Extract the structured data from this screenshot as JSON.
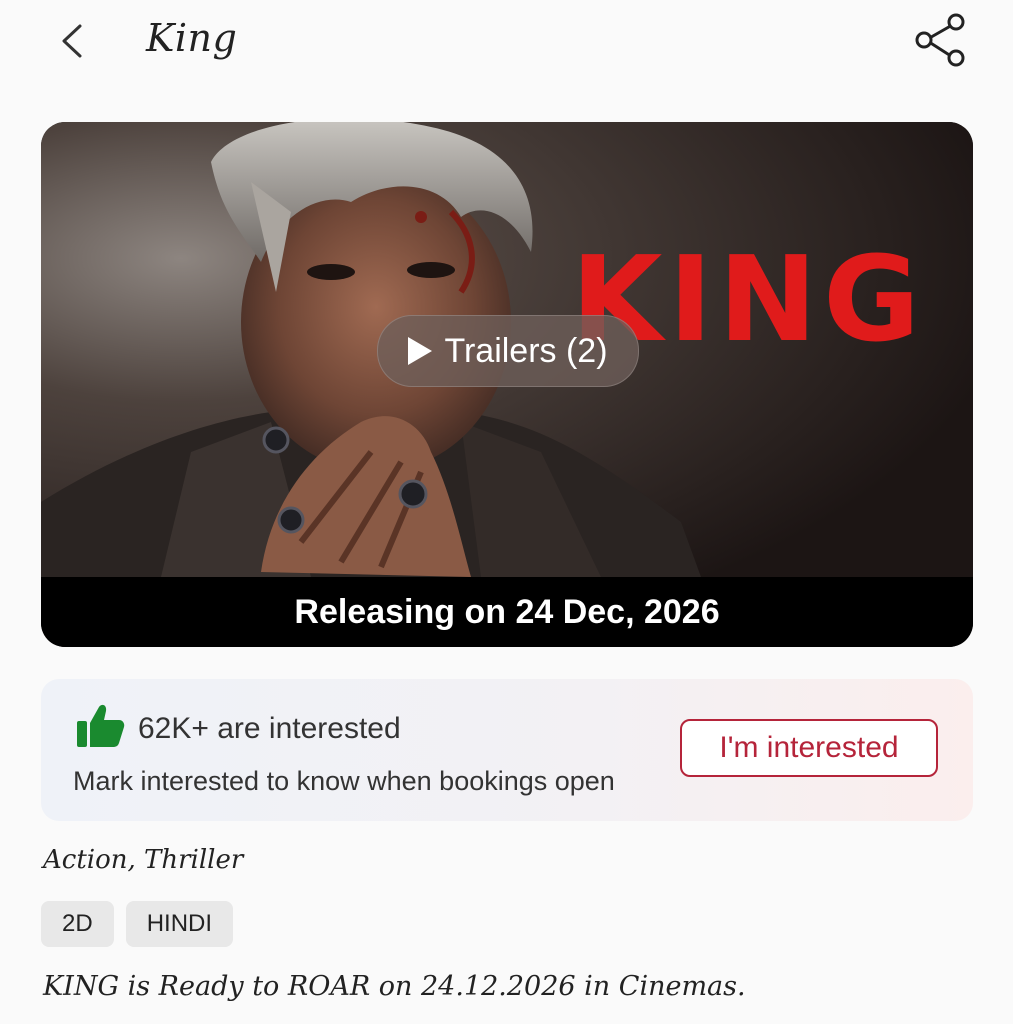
{
  "header": {
    "title": "King"
  },
  "banner": {
    "logo_text": "KING",
    "trailers_label": "Trailers (2)",
    "release_text": "Releasing on 24 Dec, 2026"
  },
  "interest": {
    "count_text": "62K+ are interested",
    "subtitle": "Mark interested to know when bookings open",
    "button_label": "I'm interested",
    "thumb_color": "#1a8a2f",
    "button_color": "#b5243a"
  },
  "details": {
    "genres": "Action, Thriller",
    "formats": [
      "2D",
      "HINDI"
    ],
    "tagline": "KING is Ready to ROAR on 24.12.2026 in Cinemas."
  },
  "icons": {
    "back": "chevron-left-icon",
    "share": "share-icon",
    "thumb": "thumbs-up-icon",
    "play": "play-icon"
  }
}
